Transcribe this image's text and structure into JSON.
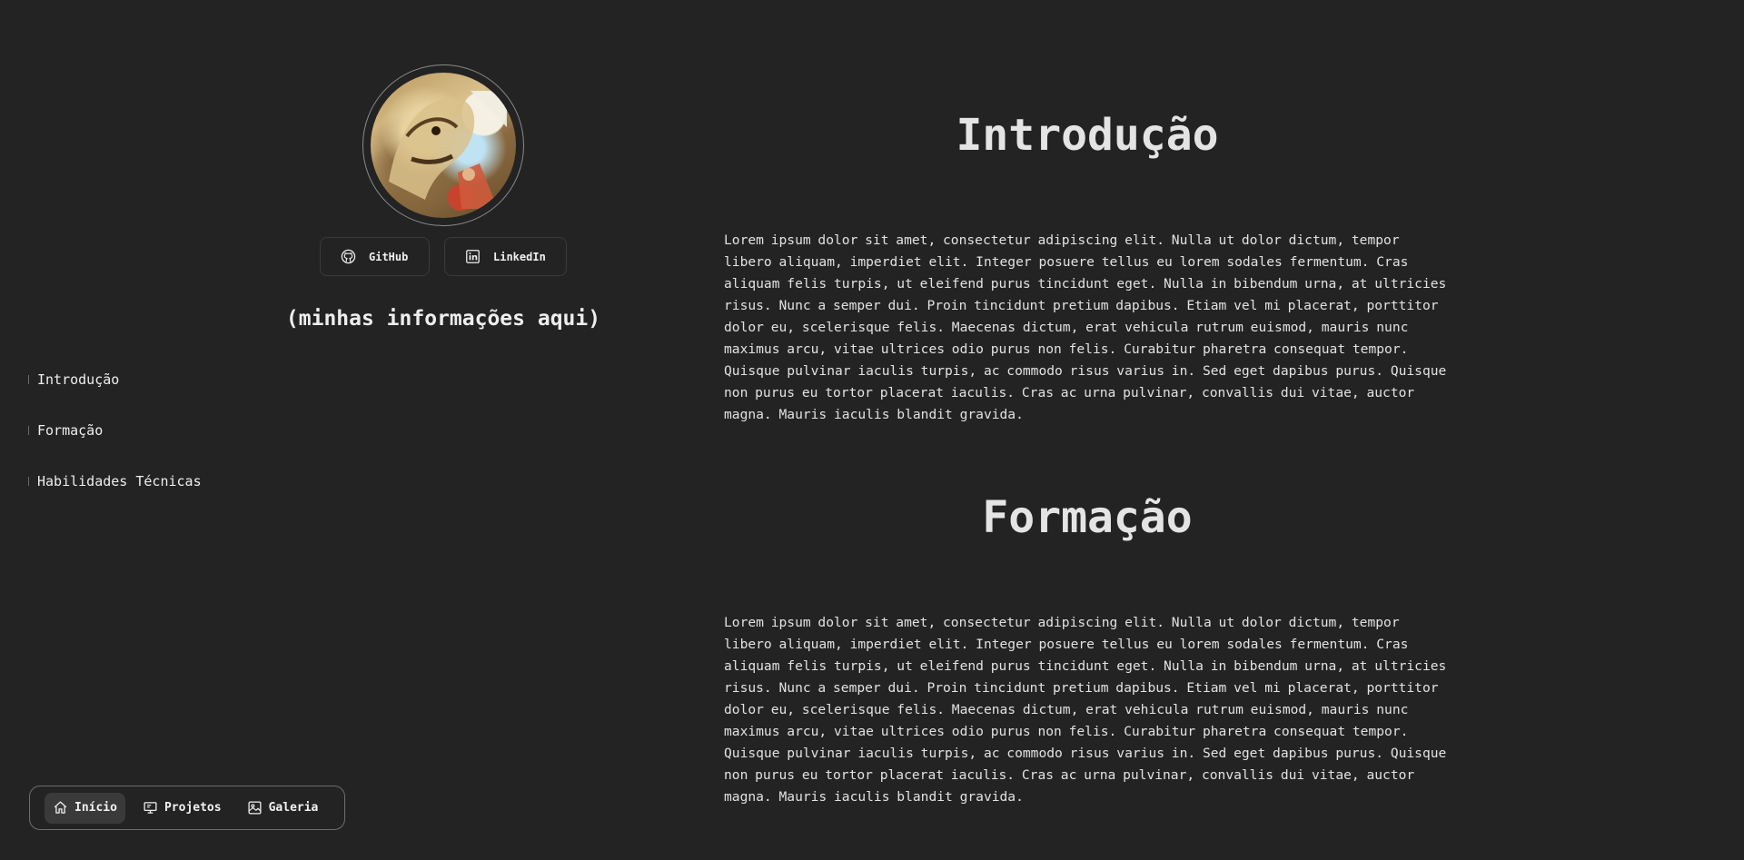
{
  "profile": {
    "avatar_alt": "avatar",
    "info_title": "(minhas informações aqui)"
  },
  "social": [
    {
      "label": "GitHub",
      "icon": "github-icon"
    },
    {
      "label": "LinkedIn",
      "icon": "linkedin-icon"
    }
  ],
  "toc": {
    "items": [
      {
        "label": "Introdução"
      },
      {
        "label": "Formação"
      },
      {
        "label": "Habilidades Técnicas"
      }
    ]
  },
  "bottom_nav": {
    "items": [
      {
        "label": "Início",
        "icon": "home-icon",
        "active": true
      },
      {
        "label": "Projetos",
        "icon": "projects-icon",
        "active": false
      },
      {
        "label": "Galeria",
        "icon": "gallery-icon",
        "active": false
      }
    ]
  },
  "sections": [
    {
      "title": "Introdução",
      "text": "Lorem ipsum dolor sit amet, consectetur adipiscing elit. Nulla ut dolor dictum, tempor libero aliquam, imperdiet elit. Integer posuere tellus eu lorem sodales fermentum. Cras aliquam felis turpis, ut eleifend purus tincidunt eget. Nulla in bibendum urna, at ultricies risus. Nunc a semper dui. Proin tincidunt pretium dapibus. Etiam vel mi placerat, porttitor dolor eu, scelerisque felis. Maecenas dictum, erat vehicula rutrum euismod, mauris nunc maximus arcu, vitae ultrices odio purus non felis. Curabitur pharetra consequat tempor. Quisque pulvinar iaculis turpis, ac commodo risus varius in. Sed eget dapibus purus. Quisque non purus eu tortor placerat iaculis. Cras ac urna pulvinar, convallis dui vitae, auctor magna. Mauris iaculis blandit gravida."
    },
    {
      "title": "Formação",
      "text": "Lorem ipsum dolor sit amet, consectetur adipiscing elit. Nulla ut dolor dictum, tempor libero aliquam, imperdiet elit. Integer posuere tellus eu lorem sodales fermentum. Cras aliquam felis turpis, ut eleifend purus tincidunt eget. Nulla in bibendum urna, at ultricies risus. Nunc a semper dui. Proin tincidunt pretium dapibus. Etiam vel mi placerat, porttitor dolor eu, scelerisque felis. Maecenas dictum, erat vehicula rutrum euismod, mauris nunc maximus arcu, vitae ultrices odio purus non felis. Curabitur pharetra consequat tempor. Quisque pulvinar iaculis turpis, ac commodo risus varius in. Sed eget dapibus purus. Quisque non purus eu tortor placerat iaculis. Cras ac urna pulvinar, convallis dui vitae, auctor magna. Mauris iaculis blandit gravida."
    }
  ],
  "colors": {
    "background": "#232323",
    "text": "#e6e6e6",
    "border": "#3a3a3a",
    "active_nav": "#3a3a3a"
  }
}
